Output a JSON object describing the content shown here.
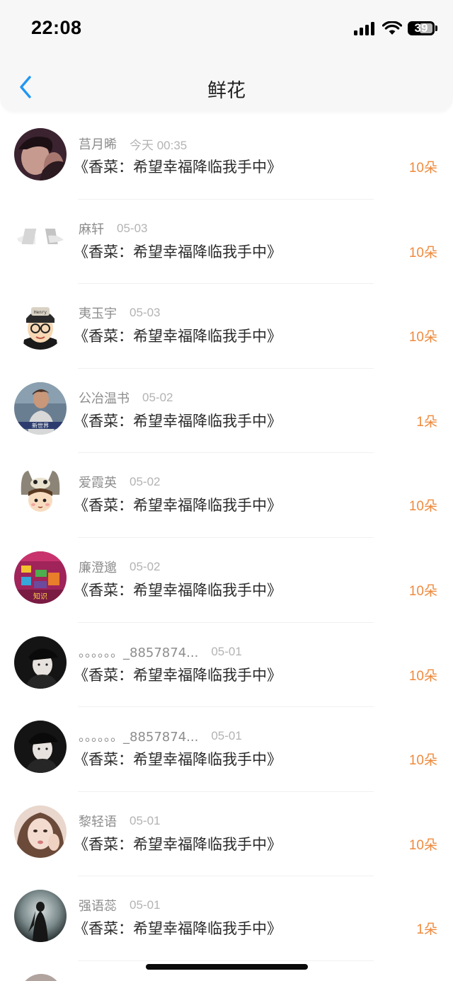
{
  "status_bar": {
    "time": "22:08",
    "battery": "39"
  },
  "header": {
    "title": "鲜花"
  },
  "items": [
    {
      "name": "莒月晞",
      "time": "今天 00:35",
      "book": "《香菜：希望幸福降临我手中》",
      "count": "10朵"
    },
    {
      "name": "麻轩",
      "time": "05-03",
      "book": "《香菜：希望幸福降临我手中》",
      "count": "10朵"
    },
    {
      "name": "夷玉宇",
      "time": "05-03",
      "book": "《香菜：希望幸福降临我手中》",
      "count": "10朵"
    },
    {
      "name": "公冶温书",
      "time": "05-02",
      "book": "《香菜：希望幸福降临我手中》",
      "count": "1朵"
    },
    {
      "name": "爱霞英",
      "time": "05-02",
      "book": "《香菜：希望幸福降临我手中》",
      "count": "10朵"
    },
    {
      "name": "廉澄邈",
      "time": "05-02",
      "book": "《香菜：希望幸福降临我手中》",
      "count": "10朵"
    },
    {
      "name": "。。。。。。_8857874...",
      "time": "05-01",
      "book": "《香菜：希望幸福降临我手中》",
      "count": "10朵"
    },
    {
      "name": "。。。。。。_8857874...",
      "time": "05-01",
      "book": "《香菜：希望幸福降临我手中》",
      "count": "10朵"
    },
    {
      "name": "黎轻语",
      "time": "05-01",
      "book": "《香菜：希望幸福降临我手中》",
      "count": "10朵"
    },
    {
      "name": "强语蕊",
      "time": "05-01",
      "book": "《香菜：希望幸福降临我手中》",
      "count": "1朵"
    }
  ],
  "avatar_icons": [
    "photo-portrait-icon",
    "logo-avatar-icon",
    "cartoon-cap-glasses-icon",
    "photo-portrait-icon",
    "cartoon-totoro-hat-icon",
    "colorful-store-icon",
    "photo-black-cap-icon",
    "photo-black-cap-icon",
    "photo-portrait-icon",
    "dark-silhouette-icon"
  ],
  "colors": {
    "accent": "#ef8a3e",
    "back_arrow": "#2196f3",
    "header_bg": "#f7f7f8"
  }
}
